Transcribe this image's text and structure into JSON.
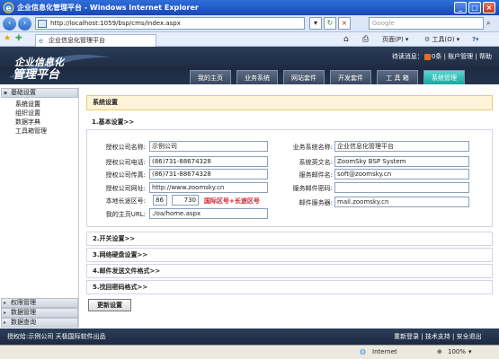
{
  "window": {
    "title": "企业信息化管理平台 - Windows Internet Explorer"
  },
  "address": {
    "url": "http://localhost:1059/bsp/cms/index.aspx",
    "search_placeholder": "Google"
  },
  "browser_tab": {
    "label": "企业信息化管理平台"
  },
  "browser_tools": {
    "page": "页面(P)",
    "tools": "工具(O)"
  },
  "header": {
    "logo_line1": "企业信息化",
    "logo_line2": "管理平台",
    "msg_label": "待读消息：",
    "msg_count": "0",
    "msg_unit": "条",
    "account": "账户管理",
    "help": "帮助"
  },
  "nav": {
    "tabs": [
      {
        "label": "我的主页"
      },
      {
        "label": "业务系统"
      },
      {
        "label": "网站套件"
      },
      {
        "label": "开发套件"
      },
      {
        "label": "工 具 箱"
      },
      {
        "label": "系统管理"
      }
    ]
  },
  "sidebar": {
    "group_basic": "基础设置",
    "items": [
      {
        "label": "系统设置"
      },
      {
        "label": "组织设置"
      },
      {
        "label": "数据字典"
      },
      {
        "label": "工具箱管理"
      }
    ],
    "group_perm": "权限管理",
    "group_data": "数据管理",
    "group_query": "数据查询"
  },
  "main": {
    "title": "系统设置",
    "sections": [
      {
        "label": "1.基本设置>>"
      },
      {
        "label": "2.开关设置>>"
      },
      {
        "label": "3.网络硬盘设置>>"
      },
      {
        "label": "4.邮件发送文件格式>>"
      },
      {
        "label": "5.找回密码格式>>"
      }
    ],
    "form": {
      "company_name_label": "授权公司名称:",
      "company_name": "示例公司",
      "phone_label": "授权公司电话:",
      "phone": "(86)731-88674328",
      "fax_label": "授权公司传真:",
      "fax": "(86)731-88674328",
      "website_label": "授权公司网址:",
      "website": "http://www.zoomsky.cn",
      "area_label": "本地长途区号:",
      "area_country": "86",
      "area_code": "730",
      "area_hint": "国际区号+长途区号",
      "homeurl_label": "我的主页URL:",
      "homeurl": "./oa/home.aspx",
      "bizname_label": "业务系统名称:",
      "bizname": "企业信息化管理平台",
      "engname_label": "系统英文名:",
      "engname": "ZoomSky BSP System",
      "sender_label": "服务邮件名:",
      "sender": "soft@zoomsky.cn",
      "mailpwd_label": "服务邮件密码:",
      "mailpwd": "",
      "mailserver_label": "邮件服务器:",
      "mailserver": "mail.zoomsky.cn"
    },
    "update_button": "更新设置"
  },
  "footer": {
    "left": "授权给:示例公司    天极国际软件出品",
    "relogin": "重新登录",
    "support": "技术支持",
    "logout": "安全退出"
  },
  "status": {
    "zone": "Internet",
    "zoom": "100%"
  },
  "colors": {
    "header": "#1d2a40",
    "active_tab": "#16a9a0",
    "hint": "#d0202a",
    "notice_bg": "#fdf3d7"
  }
}
